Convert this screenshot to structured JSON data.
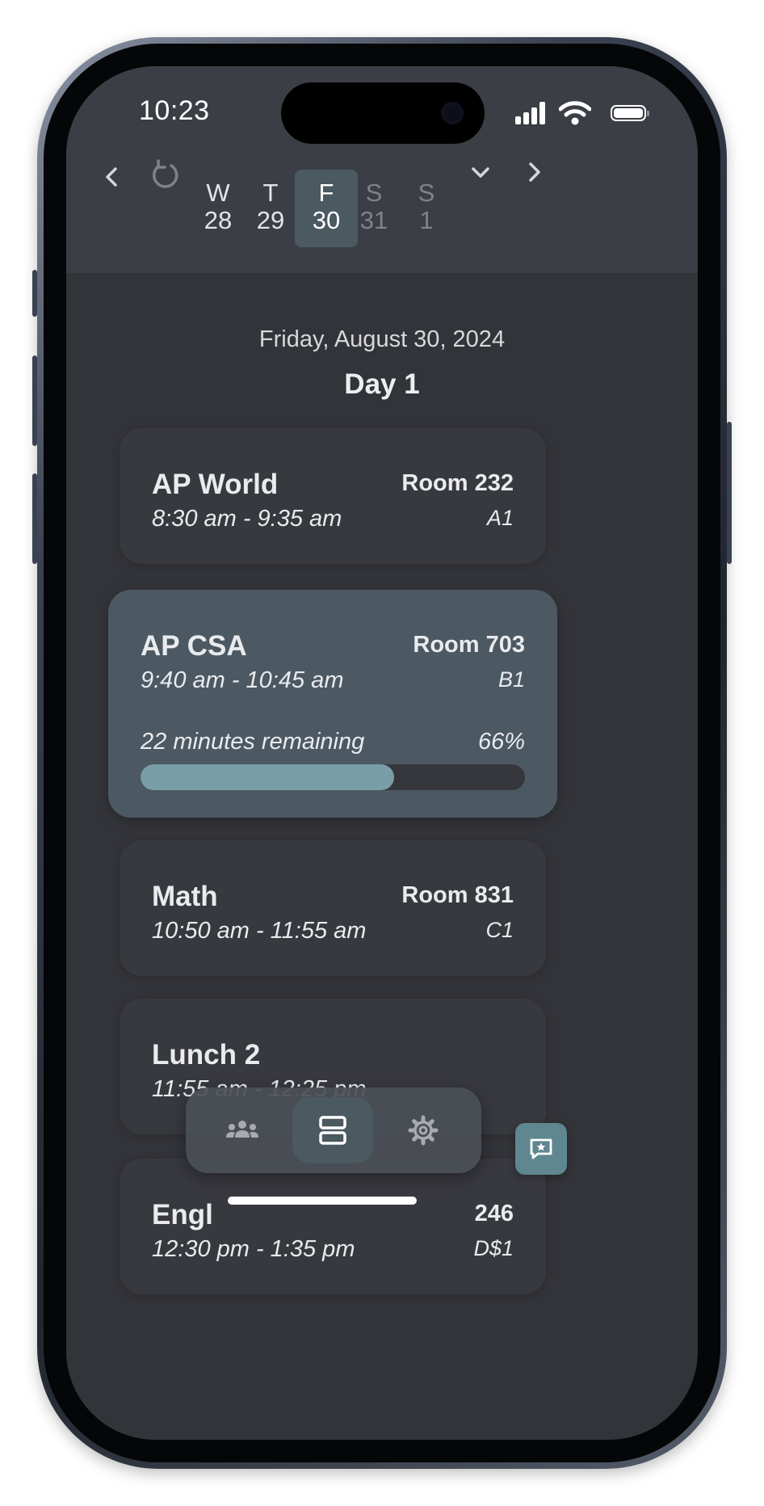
{
  "status": {
    "time": "10:23"
  },
  "week_nav": {
    "prev_icon": "chevron-left-icon",
    "reset_icon": "refresh-icon",
    "expand_icon": "chevron-down-icon",
    "next_icon": "chevron-right-icon",
    "days": [
      {
        "letter": "W",
        "number": "28",
        "selected": false,
        "weekend": false
      },
      {
        "letter": "T",
        "number": "29",
        "selected": false,
        "weekend": false
      },
      {
        "letter": "F",
        "number": "30",
        "selected": true,
        "weekend": false
      },
      {
        "letter": "S",
        "number": "31",
        "selected": false,
        "weekend": true
      },
      {
        "letter": "S",
        "number": "1",
        "selected": false,
        "weekend": true
      }
    ]
  },
  "schedule": {
    "date": "Friday, August 30, 2024",
    "day": "Day 1",
    "periods": [
      {
        "name": "AP World",
        "time": "8:30 am - 9:35 am",
        "room": "Room 232",
        "code": "A1"
      },
      {
        "name": "AP CSA",
        "time": "9:40 am - 10:45 am",
        "room": "Room 703",
        "code": "B1",
        "active": true,
        "remaining": "22 minutes remaining",
        "percent_label": "66%",
        "progress": 0.66
      },
      {
        "name": "Math",
        "time": "10:50 am - 11:55 am",
        "room": "Room 831",
        "code": "C1"
      },
      {
        "name": "Lunch 2",
        "time": "11:55 am - 12:25 pm"
      },
      {
        "name": "Engl",
        "time": "12:30 pm - 1:35 pm",
        "room": "246",
        "code": "D$1"
      }
    ]
  },
  "tabbar": {
    "tabs": [
      {
        "icon": "people-icon",
        "selected": false
      },
      {
        "icon": "schedule-icon",
        "selected": true
      },
      {
        "icon": "gear-icon",
        "selected": false
      }
    ]
  },
  "fab": {
    "icon": "feedback-icon"
  },
  "colors": {
    "accent": "#5f8790",
    "progress": "#7a9ea7",
    "active_card": "#4c5962",
    "background": "#333439"
  }
}
